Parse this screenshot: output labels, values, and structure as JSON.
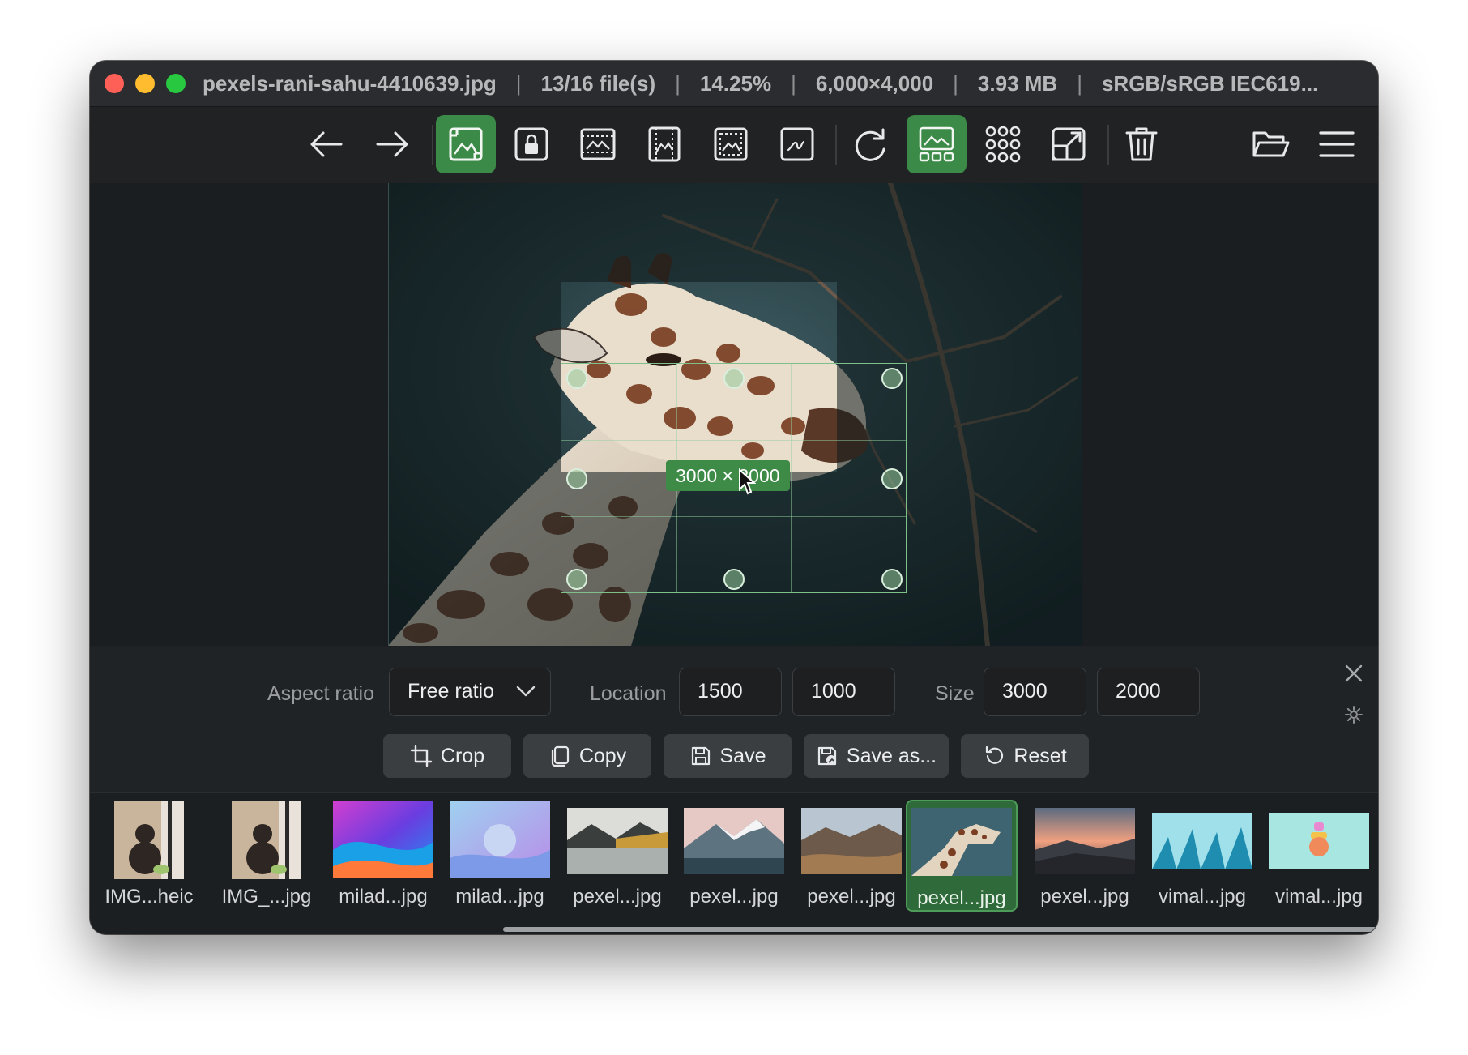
{
  "title_bar": {
    "filename": "pexels-rani-sahu-4410639.jpg",
    "file_count": "13/16 file(s)",
    "zoom": "14.25%",
    "dimensions": "6,000×4,000",
    "file_size": "3.93 MB",
    "color_profile": "sRGB/sRGB IEC619...",
    "separator": "|"
  },
  "toolbar": {
    "icons": [
      "arrow-left-icon",
      "arrow-right-icon",
      "crop-tool-icon",
      "lock-crop-icon",
      "frame-horizontal-icon",
      "frame-vertical-icon",
      "frame-dashed-icon",
      "signature-icon",
      "refresh-icon",
      "gallery-view-icon",
      "grid-view-icon",
      "expand-icon",
      "trash-icon",
      "folder-open-icon",
      "hamburger-menu-icon"
    ],
    "accent_color": "#3c8a47"
  },
  "viewer": {
    "crop_size_label": "3000 × 2000"
  },
  "crop_panel": {
    "aspect_ratio_label": "Aspect ratio",
    "aspect_ratio_value": "Free ratio",
    "location_label": "Location",
    "location_x": "1500",
    "location_y": "1000",
    "size_label": "Size",
    "size_w": "3000",
    "size_h": "2000",
    "buttons": {
      "crop": "Crop",
      "copy": "Copy",
      "save": "Save",
      "save_as": "Save as...",
      "reset": "Reset"
    }
  },
  "filmstrip": {
    "items": [
      {
        "name": "IMG...heic"
      },
      {
        "name": "IMG_...jpg"
      },
      {
        "name": "milad...jpg"
      },
      {
        "name": "milad...jpg"
      },
      {
        "name": "pexel...jpg"
      },
      {
        "name": "pexel...jpg"
      },
      {
        "name": "pexel...jpg"
      },
      {
        "name": "pexel...jpg",
        "selected": true
      },
      {
        "name": "pexel...jpg"
      },
      {
        "name": "vimal...jpg"
      },
      {
        "name": "vimal...jpg"
      }
    ]
  }
}
